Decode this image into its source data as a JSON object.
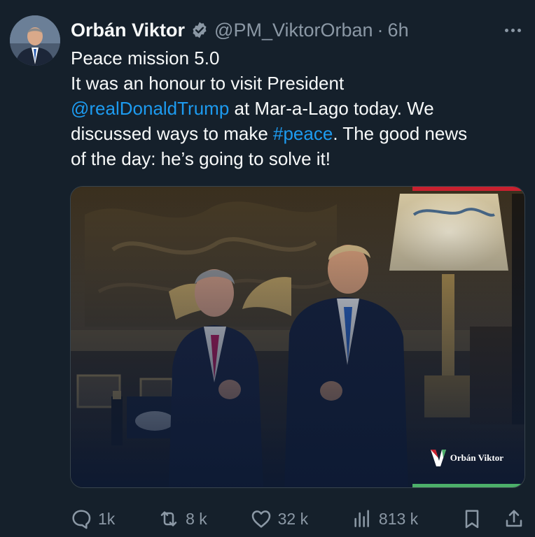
{
  "tweet": {
    "author_name": "Orbán Viktor",
    "handle": "@PM_ViktorOrban",
    "separator": "·",
    "time": "6h",
    "lines": [
      [
        {
          "t": "Peace mission 5.0"
        }
      ],
      [
        {
          "t": "It was an honour to visit President"
        }
      ],
      [
        {
          "t": "@realDonaldTrump",
          "link": true
        },
        {
          "t": " at Mar-a-Lago today. We"
        }
      ],
      [
        {
          "t": "discussed ways to make "
        },
        {
          "t": "#peace",
          "link": true
        },
        {
          "t": ". The good news"
        }
      ],
      [
        {
          "t": "of the day: he’s going to solve it!"
        }
      ]
    ],
    "media": {
      "watermark": "Orbán Viktor"
    },
    "actions": {
      "replies": "1k",
      "reposts": "8 k",
      "likes": "32 k",
      "views": "813 k"
    }
  },
  "colors": {
    "background": "#15202b",
    "text": "#f7f9f9",
    "muted": "#8b98a5",
    "link": "#1d9bf0",
    "verified": "#8b98a5"
  },
  "icons": {
    "verified": "verified-badge-icon",
    "more": "more-options-icon",
    "reply": "reply-icon",
    "repost": "repost-icon",
    "like": "heart-icon",
    "views": "views-icon",
    "bookmark": "bookmark-icon",
    "share": "share-icon"
  }
}
